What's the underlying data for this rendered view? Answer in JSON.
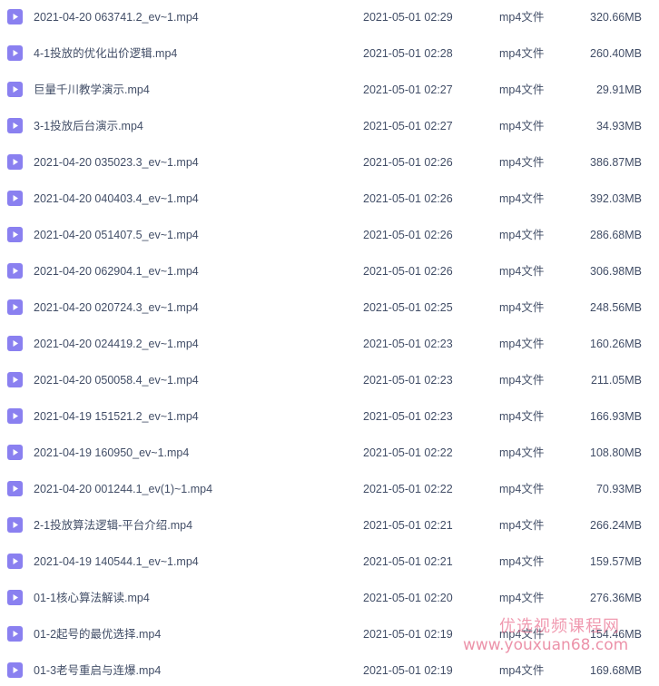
{
  "icon": {
    "name": "video-file-icon",
    "color": "#8a80f0",
    "glyph_color": "#ffffff"
  },
  "files": [
    {
      "name": "2021-04-20 063741.2_ev~1.mp4",
      "date": "2021-05-01 02:29",
      "type": "mp4文件",
      "size": "320.66MB"
    },
    {
      "name": "4-1投放的优化出价逻辑.mp4",
      "date": "2021-05-01 02:28",
      "type": "mp4文件",
      "size": "260.40MB"
    },
    {
      "name": "巨量千川教学演示.mp4",
      "date": "2021-05-01 02:27",
      "type": "mp4文件",
      "size": "29.91MB"
    },
    {
      "name": "3-1投放后台演示.mp4",
      "date": "2021-05-01 02:27",
      "type": "mp4文件",
      "size": "34.93MB"
    },
    {
      "name": "2021-04-20 035023.3_ev~1.mp4",
      "date": "2021-05-01 02:26",
      "type": "mp4文件",
      "size": "386.87MB"
    },
    {
      "name": "2021-04-20 040403.4_ev~1.mp4",
      "date": "2021-05-01 02:26",
      "type": "mp4文件",
      "size": "392.03MB"
    },
    {
      "name": "2021-04-20 051407.5_ev~1.mp4",
      "date": "2021-05-01 02:26",
      "type": "mp4文件",
      "size": "286.68MB"
    },
    {
      "name": "2021-04-20 062904.1_ev~1.mp4",
      "date": "2021-05-01 02:26",
      "type": "mp4文件",
      "size": "306.98MB"
    },
    {
      "name": "2021-04-20 020724.3_ev~1.mp4",
      "date": "2021-05-01 02:25",
      "type": "mp4文件",
      "size": "248.56MB"
    },
    {
      "name": "2021-04-20 024419.2_ev~1.mp4",
      "date": "2021-05-01 02:23",
      "type": "mp4文件",
      "size": "160.26MB"
    },
    {
      "name": "2021-04-20 050058.4_ev~1.mp4",
      "date": "2021-05-01 02:23",
      "type": "mp4文件",
      "size": "211.05MB"
    },
    {
      "name": "2021-04-19 151521.2_ev~1.mp4",
      "date": "2021-05-01 02:23",
      "type": "mp4文件",
      "size": "166.93MB"
    },
    {
      "name": "2021-04-19 160950_ev~1.mp4",
      "date": "2021-05-01 02:22",
      "type": "mp4文件",
      "size": "108.80MB"
    },
    {
      "name": "2021-04-20 001244.1_ev(1)~1.mp4",
      "date": "2021-05-01 02:22",
      "type": "mp4文件",
      "size": "70.93MB"
    },
    {
      "name": "2-1投放算法逻辑-平台介绍.mp4",
      "date": "2021-05-01 02:21",
      "type": "mp4文件",
      "size": "266.24MB"
    },
    {
      "name": "2021-04-19 140544.1_ev~1.mp4",
      "date": "2021-05-01 02:21",
      "type": "mp4文件",
      "size": "159.57MB"
    },
    {
      "name": "01-1核心算法解读.mp4",
      "date": "2021-05-01 02:20",
      "type": "mp4文件",
      "size": "276.36MB"
    },
    {
      "name": "01-2起号的最优选择.mp4",
      "date": "2021-05-01 02:19",
      "type": "mp4文件",
      "size": "154.46MB"
    },
    {
      "name": "01-3老号重启与连爆.mp4",
      "date": "2021-05-01 02:19",
      "type": "mp4文件",
      "size": "169.68MB"
    }
  ],
  "watermark": {
    "title": "优选视频课程网",
    "url": "www.youxuan68.com"
  }
}
